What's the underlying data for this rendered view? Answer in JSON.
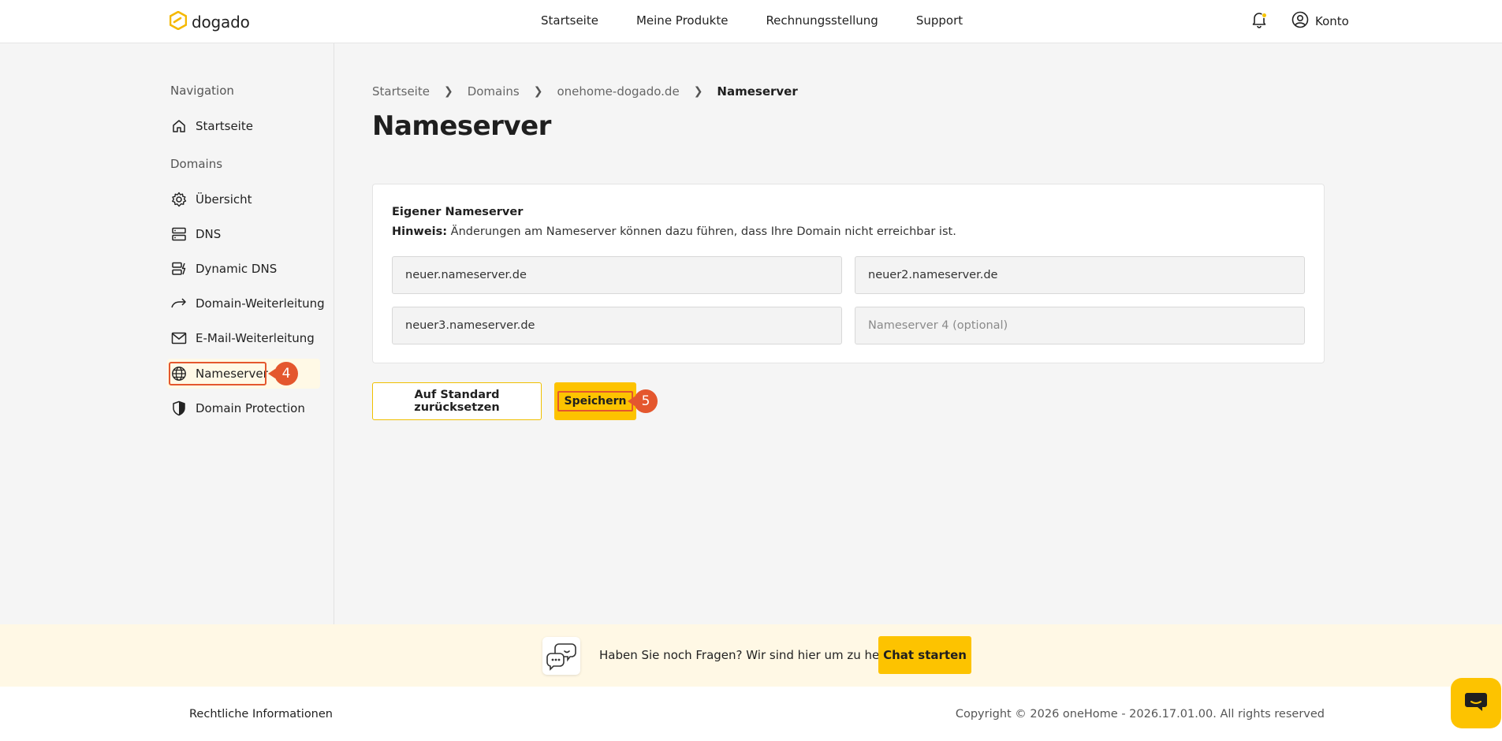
{
  "header": {
    "brand": "dogado",
    "nav": [
      "Startseite",
      "Meine Produkte",
      "Rechnungsstellung",
      "Support"
    ],
    "account_label": "Konto",
    "accent_color": "#fdc300",
    "notification_color": "#f5c400"
  },
  "sidebar": {
    "navigation_heading": "Navigation",
    "home_label": "Startseite",
    "domains_heading": "Domains",
    "items": [
      {
        "label": "Übersicht",
        "icon": "gear-icon"
      },
      {
        "label": "DNS",
        "icon": "server-icon"
      },
      {
        "label": "Dynamic DNS",
        "icon": "dynamic-dns-icon"
      },
      {
        "label": "Domain-Weiterleitung",
        "icon": "forward-arrow-icon"
      },
      {
        "label": "E-Mail-Weiterleitung",
        "icon": "mail-icon"
      },
      {
        "label": "Nameserver",
        "icon": "globe-icon",
        "active": true
      },
      {
        "label": "Domain Protection",
        "icon": "shield-icon"
      }
    ],
    "step_badge": "4"
  },
  "breadcrumb": [
    "Startseite",
    "Domains",
    "onehome-dogado.de",
    "Nameserver"
  ],
  "page_title": "Nameserver",
  "card": {
    "title": "Eigener Nameserver",
    "hint_label": "Hinweis:",
    "hint_text": "Änderungen am Nameserver können dazu führen, dass Ihre Domain nicht erreichbar ist.",
    "fields": [
      {
        "value": "neuer.nameserver.de",
        "placeholder": ""
      },
      {
        "value": "neuer2.nameserver.de",
        "placeholder": ""
      },
      {
        "value": "neuer3.nameserver.de",
        "placeholder": ""
      },
      {
        "value": "",
        "placeholder": "Nameserver 4 (optional)"
      }
    ]
  },
  "actions": {
    "reset_label": "Auf Standard zurücksetzen",
    "save_label": "Speichern",
    "step_badge": "5"
  },
  "help": {
    "text": "Haben Sie noch Fragen? Wir sind hier um zu helfen.",
    "chat_button": "Chat starten"
  },
  "footer": {
    "legal": "Rechtliche Informationen",
    "copyright": "Copyright © 2026 oneHome - 2026.17.01.00. All rights reserved"
  }
}
